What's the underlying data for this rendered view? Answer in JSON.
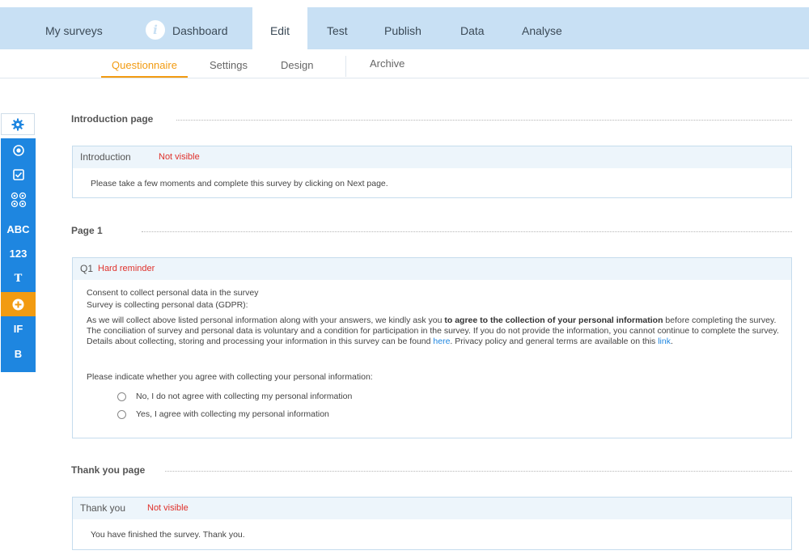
{
  "topnav": {
    "tabs": [
      {
        "label": "My surveys"
      },
      {
        "label": "Dashboard"
      },
      {
        "label": "Edit"
      },
      {
        "label": "Test"
      },
      {
        "label": "Publish"
      },
      {
        "label": "Data"
      },
      {
        "label": "Analyse"
      }
    ],
    "info_glyph": "i",
    "active_tab": "Edit"
  },
  "subnav": {
    "tabs": [
      {
        "label": "Questionnaire"
      },
      {
        "label": "Settings"
      },
      {
        "label": "Design"
      },
      {
        "label": "Archive"
      }
    ],
    "active_tab": "Questionnaire"
  },
  "sidebar": {
    "items": [
      {
        "icon": "radio-question-icon"
      },
      {
        "icon": "checkbox-question-icon"
      },
      {
        "icon": "matrix-question-icon"
      },
      {
        "label": "ABC"
      },
      {
        "label": "123"
      },
      {
        "label": "T"
      },
      {
        "icon": "add-icon"
      },
      {
        "label": "IF"
      },
      {
        "label": "B"
      }
    ]
  },
  "intro": {
    "section_title": "Introduction page",
    "card_title": "Introduction",
    "flag": "Not visible",
    "text": "Please take a few moments and complete this survey by clicking on Next page."
  },
  "page1": {
    "section_title": "Page 1",
    "q_id": "Q1",
    "flag": "Hard reminder",
    "line1": "Consent to collect personal data in the survey",
    "line2": "Survey is collecting personal data (GDPR):",
    "para_start": "As we will collect above listed personal information along with your answers, we kindly ask you ",
    "para_bold": "to agree to the collection of your personal information",
    "para_mid": " before completing the survey. The conciliation of survey and personal data is voluntary and a condition for participation in the survey. If you do not provide the information, you cannot continue to complete the survey. Details about collecting, storing and processing your information in this survey can be found ",
    "link_here": "here",
    "para_mid2": ". Privacy policy and general terms are available on this ",
    "link_link": "link",
    "para_end": ".",
    "prompt": "Please indicate whether you agree with collecting your personal information:",
    "options": [
      {
        "label": "No, I do not agree with collecting my personal information"
      },
      {
        "label": "Yes, I agree with collecting my personal information"
      }
    ]
  },
  "thanks": {
    "section_title": "Thank you page",
    "card_title": "Thank you",
    "flag": "Not visible",
    "text": "You have finished the survey. Thank you."
  },
  "colors": {
    "nav_bg": "#c8e0f4",
    "accent_orange": "#f29b11",
    "sidebar_blue": "#1e86e0",
    "flag_red": "#e0312b"
  }
}
